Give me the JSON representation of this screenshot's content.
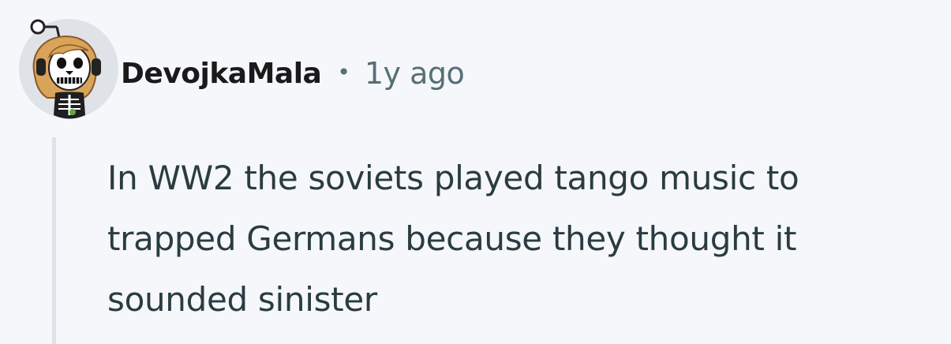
{
  "comment": {
    "author": "DevojkaMala",
    "separator": "•",
    "timestamp": "1y ago",
    "avatar_icon": "snoo-skeleton-avatar-icon",
    "body_lines": [
      "In WW2 the soviets played tango music to",
      "trapped Germans because they thought it",
      "sounded sinister"
    ]
  },
  "colors": {
    "background": "#f5f7fa",
    "username": "#1a1a1b",
    "meta": "#576f76",
    "body": "#2a3c42",
    "thread_line": "#dde3e8",
    "avatar_bg": "#dfe3e8",
    "avatar_hair": "#d9a35a"
  }
}
